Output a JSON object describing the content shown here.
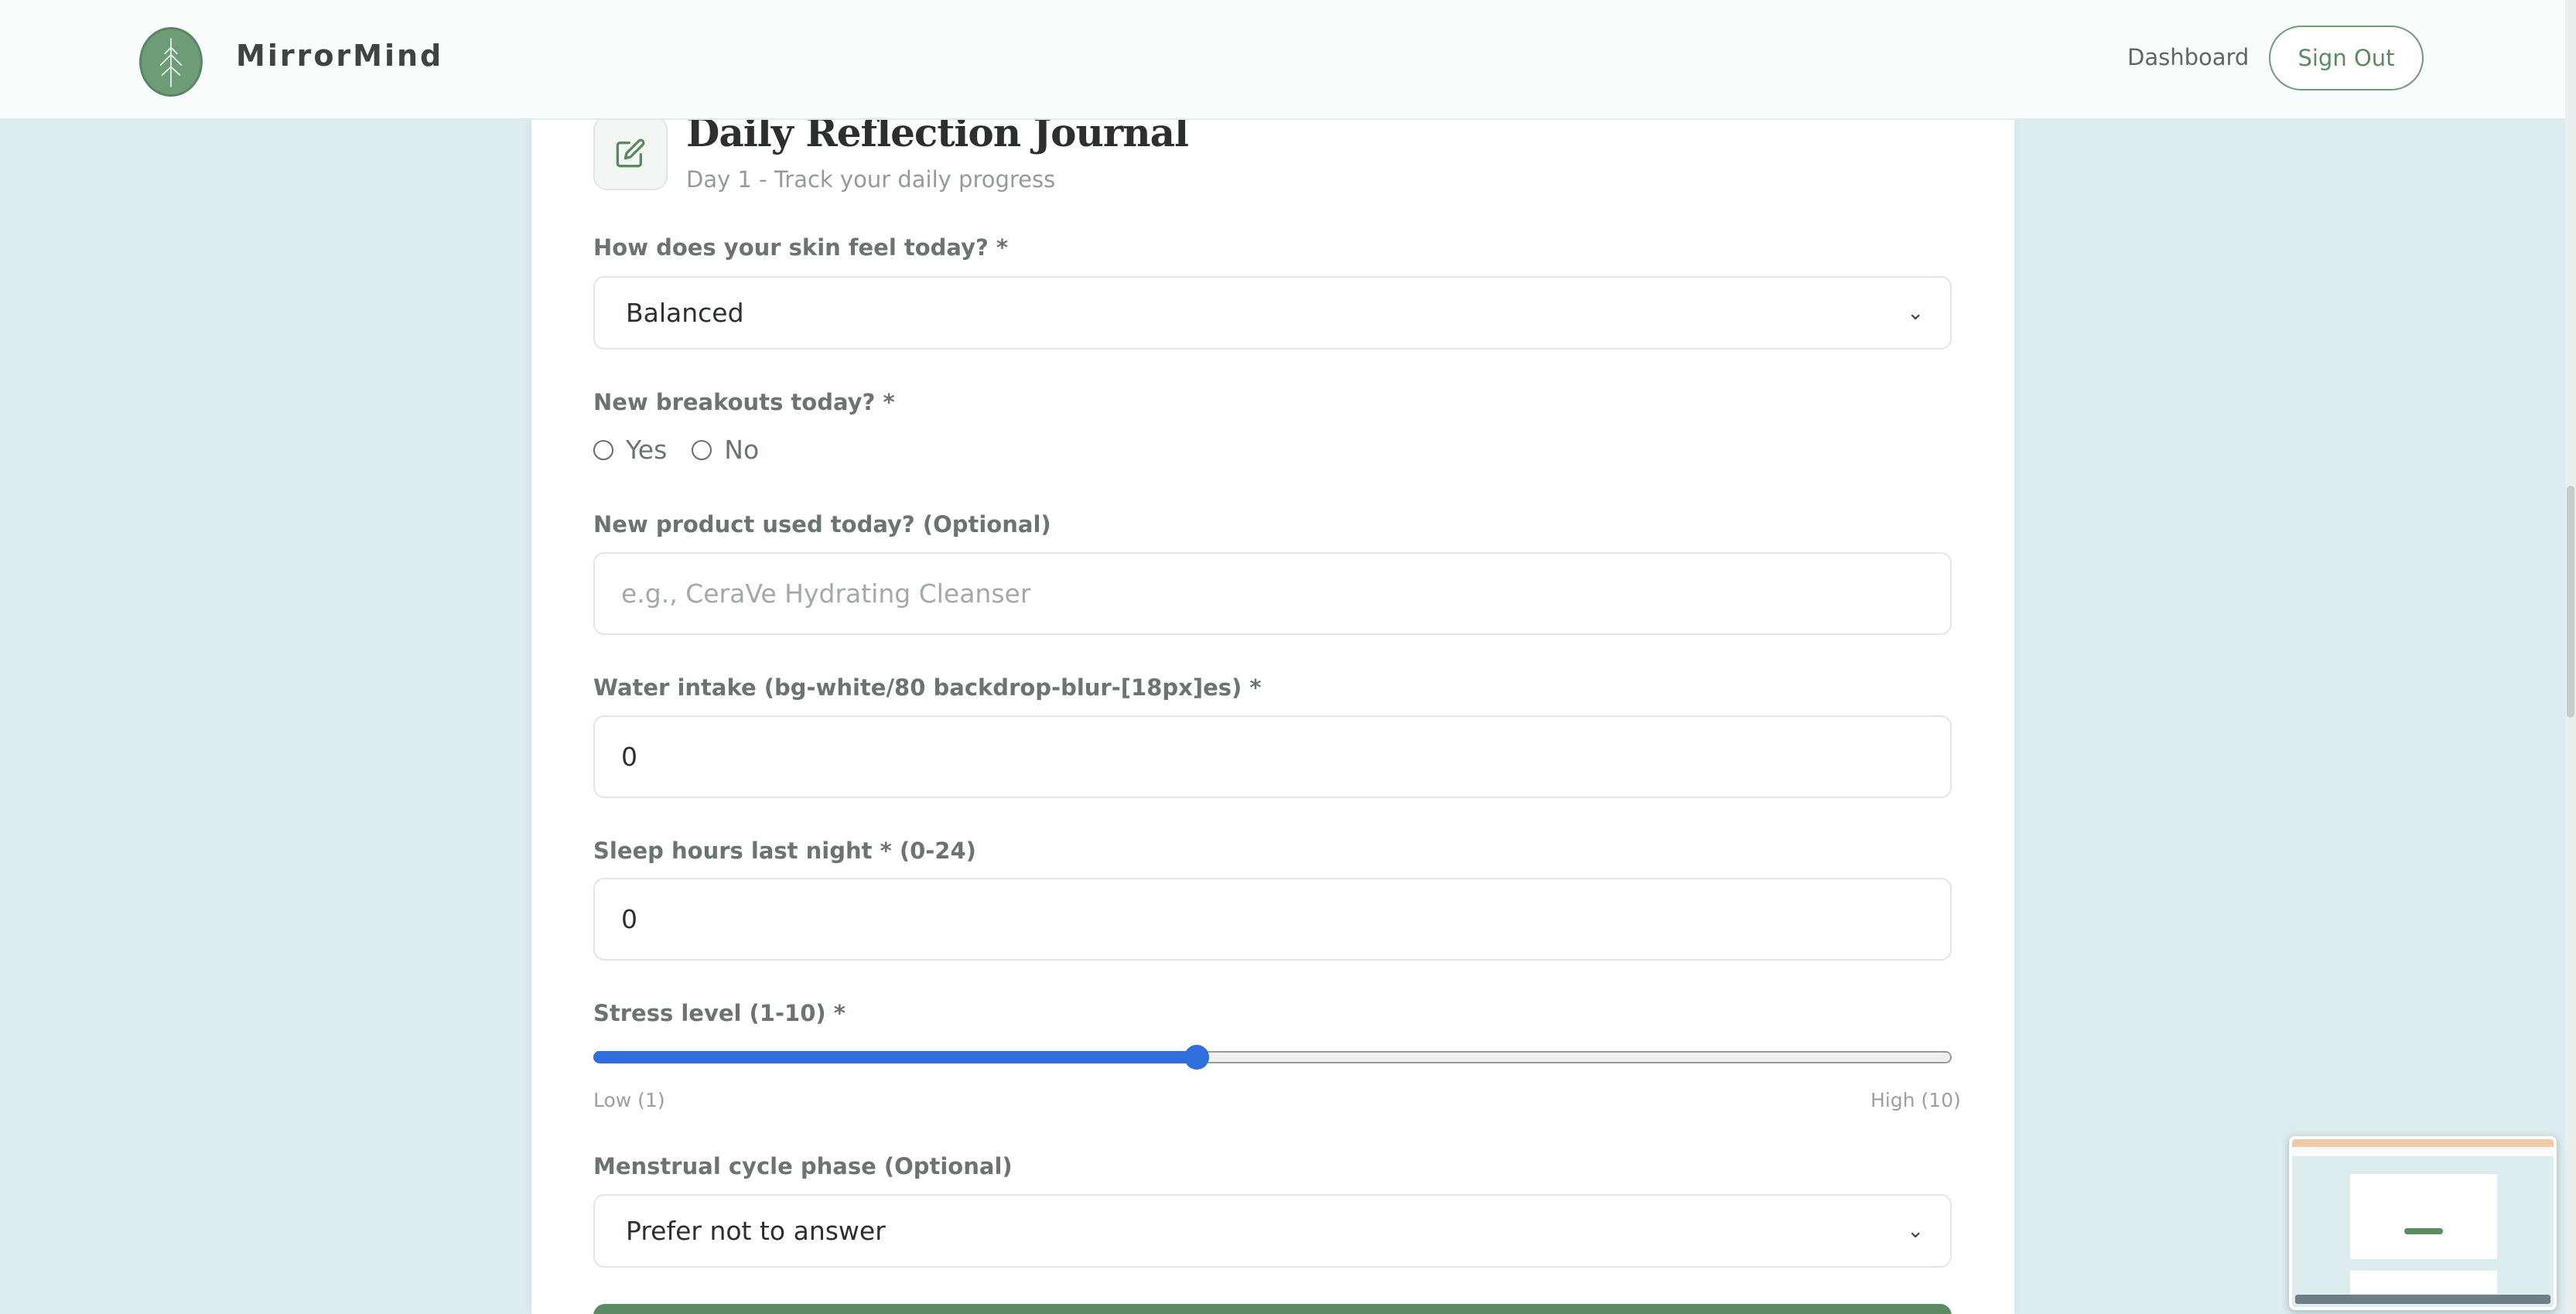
{
  "header": {
    "brand": "MirrorMind",
    "nav_dashboard": "Dashboard",
    "sign_out": "Sign Out"
  },
  "journal": {
    "title": "Daily Reflection Journal",
    "subtitle": "Day 1 - Track your daily progress"
  },
  "form": {
    "skin_label": "How does your skin feel today? *",
    "skin_value": "Balanced",
    "breakouts_label": "New breakouts today? *",
    "breakouts_yes": "Yes",
    "breakouts_no": "No",
    "product_label": "New product used today? (Optional)",
    "product_placeholder": "e.g., CeraVe Hydrating Cleanser",
    "water_label": "Water intake (bg-white/80 backdrop-blur-[18px]es) *",
    "water_value": "0",
    "sleep_label": "Sleep hours last night * (0-24)",
    "sleep_value": "0",
    "stress_label": "Stress level (1-10) *",
    "stress_value": 5,
    "stress_min": 1,
    "stress_max": 10,
    "stress_low_label": "Low (1)",
    "stress_high_label": "High (10)",
    "cycle_label": "Menstrual cycle phase (Optional)",
    "cycle_value": "Prefer not to answer"
  },
  "colors": {
    "brand_green": "#6e9c76",
    "slider_blue": "#2f6fdd",
    "background": "#dcecef"
  }
}
